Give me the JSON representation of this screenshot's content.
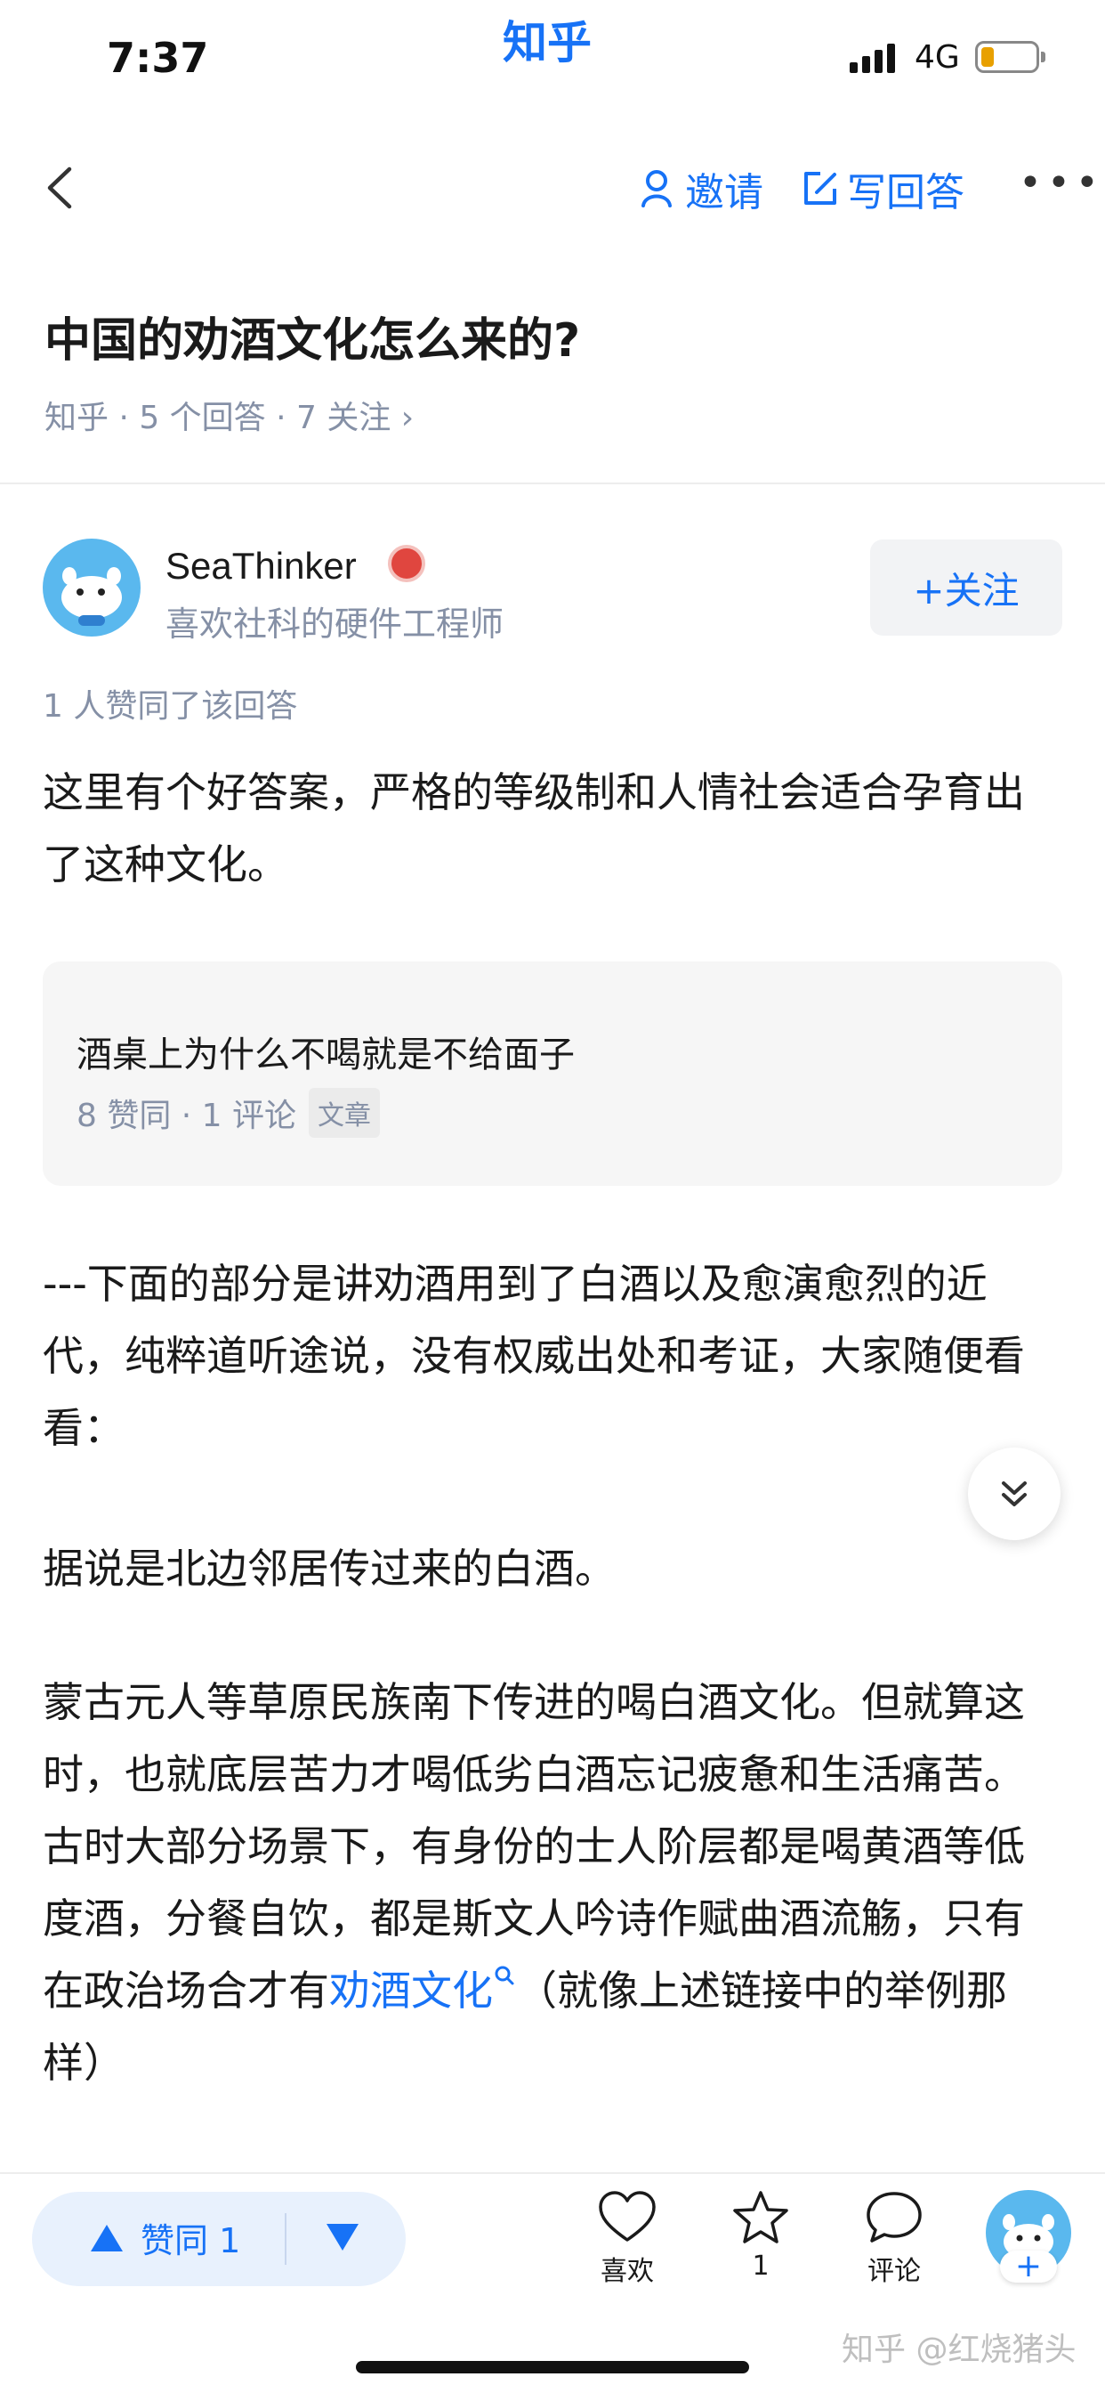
{
  "status_bar": {
    "time": "7:37",
    "app_logo": "知乎",
    "network": "4G"
  },
  "nav": {
    "invite_label": "邀请",
    "write_answer_label": "写回答"
  },
  "question": {
    "title": "中国的劝酒文化怎么来的?",
    "meta": "知乎 · 5 个回答 · 7 关注 ›"
  },
  "author": {
    "name": "SeaThinker",
    "bio": "喜欢社科的硬件工程师",
    "follow_label": "+关注"
  },
  "upvote_note": "1 人赞同了该回答",
  "answer": {
    "p1": "这里有个好答案，严格的等级制和人情社会适合孕育出了这种文化。",
    "card": {
      "title": "酒桌上为什么不喝就是不给面子",
      "meta": "8 赞同 · 1 评论",
      "tag": "文章"
    },
    "p2": "---下面的部分是讲劝酒用到了白酒以及愈演愈烈的近代，纯粹道听途说，没有权威出处和考证，大家随便看看：",
    "p3": "据说是北边邻居传过来的白酒。",
    "p4_before": "蒙古元人等草原民族南下传进的喝白酒文化。但就算这时，也就底层苦力才喝低劣白酒忘记疲惫和生活痛苦。古时大部分场景下，有身份的士人阶层都是喝黄酒等低度酒，分餐自饮，都是斯文人吟诗作赋曲酒流觞，只有在政治场合才有",
    "p4_link": "劝酒文化",
    "p4_after": "（就像上述链接中的举例那样）"
  },
  "bottom_bar": {
    "vote_label": "赞同 1",
    "like_label": "喜欢",
    "favorite_label": "1",
    "comment_label": "评论",
    "fab_plus": "+"
  },
  "watermark": "知乎 @红烧猪头",
  "icons": [
    "back-icon",
    "invite-icon",
    "edit-icon",
    "more-icon",
    "chevron-down-icon",
    "heart-icon",
    "star-icon",
    "comment-icon"
  ],
  "colors": {
    "accent": "#1772f6",
    "muted": "#8590a6"
  }
}
